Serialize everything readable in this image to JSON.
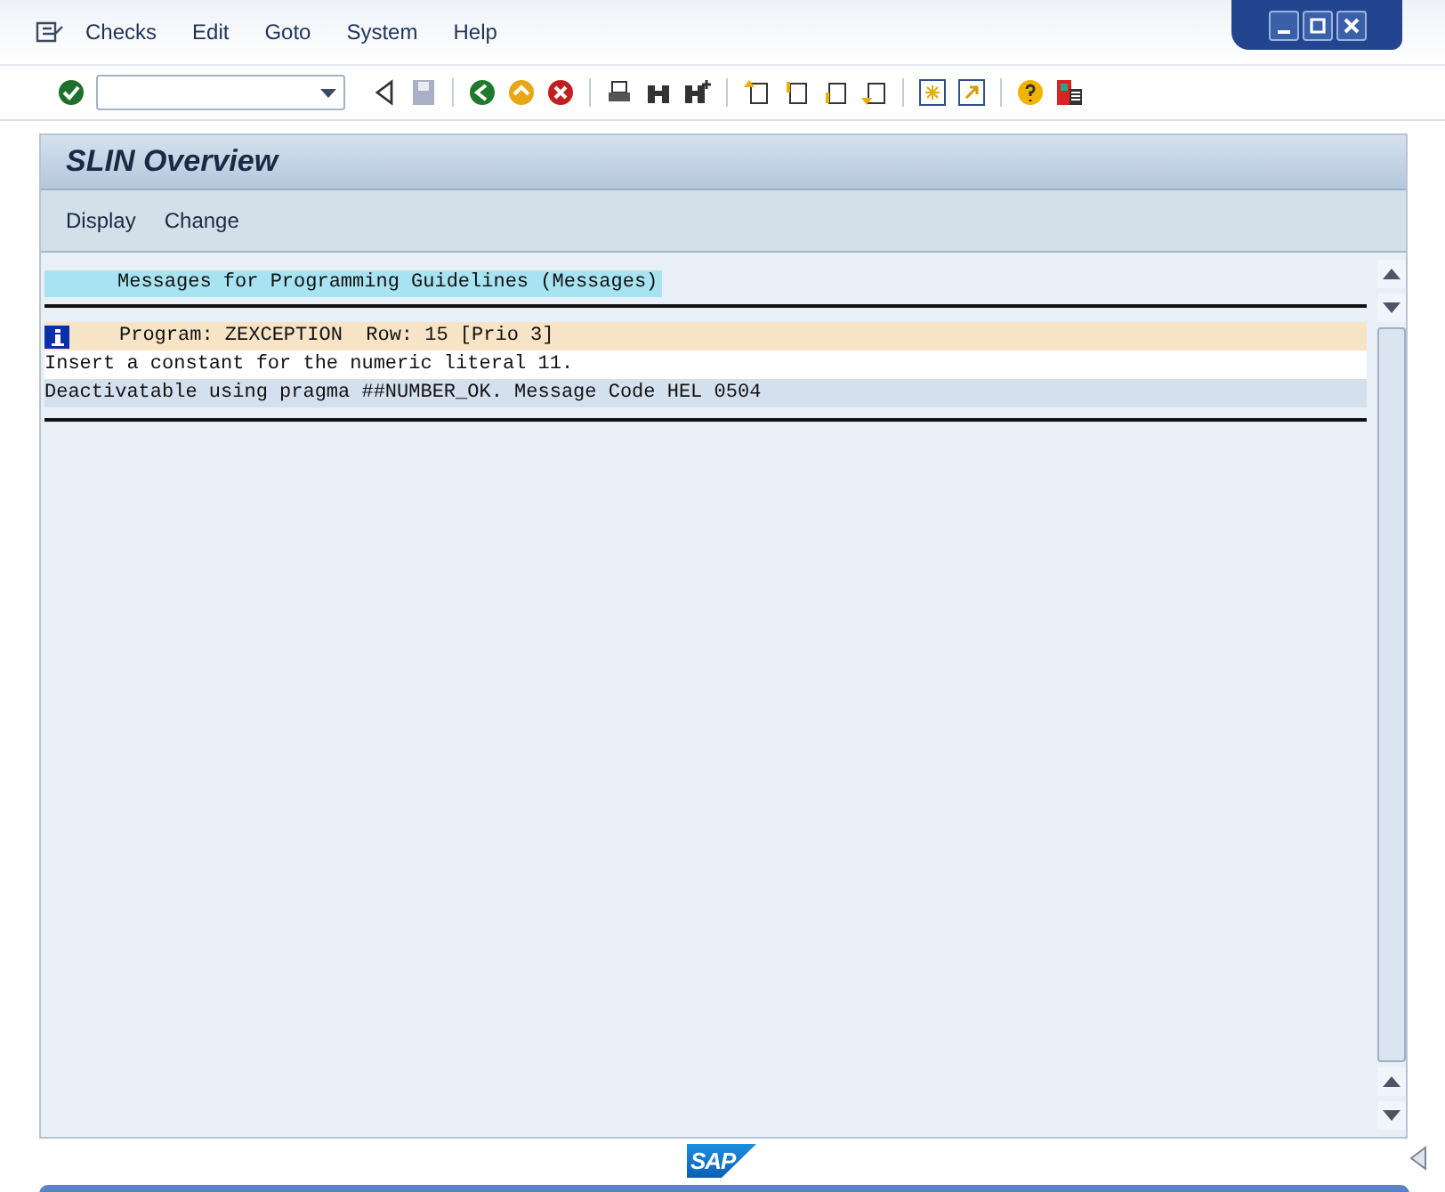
{
  "menu": [
    "Checks",
    "Edit",
    "Goto",
    "System",
    "Help"
  ],
  "screen": {
    "title": "SLIN Overview",
    "actions": [
      "Display",
      "Change"
    ]
  },
  "list": {
    "header": "Messages for Programming Guidelines (Messages)",
    "messages": [
      {
        "kind": "info",
        "location": "Program: ZEXCEPTION  Row: 15 [Prio 3]",
        "text": "Insert a constant for the numeric literal 11.",
        "note": "Deactivatable using pragma ##NUMBER_OK. Message Code HEL 0504"
      }
    ]
  },
  "footer": {
    "logo": "SAP"
  }
}
